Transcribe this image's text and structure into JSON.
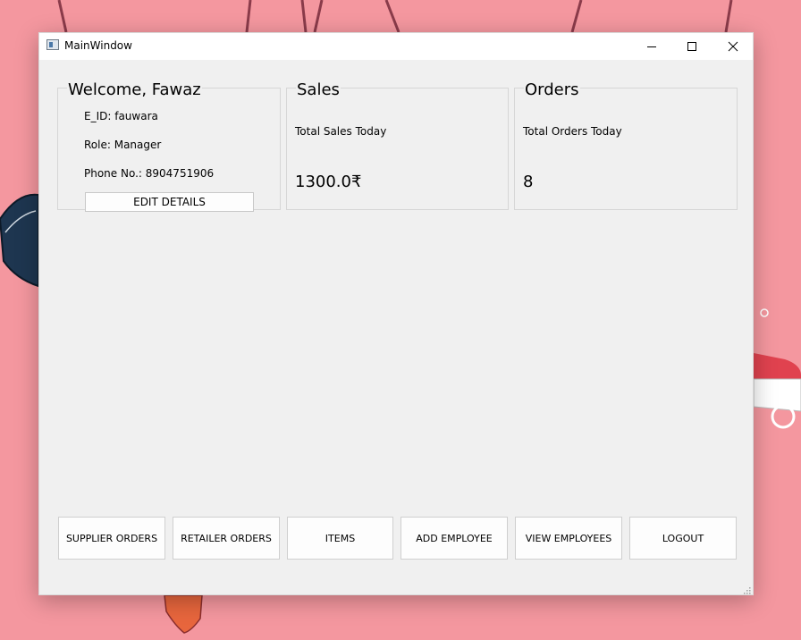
{
  "window": {
    "title": "MainWindow"
  },
  "welcome": {
    "title": "Welcome, Fawaz",
    "eid": "E_ID: fauwara",
    "role": "Role: Manager",
    "phone": "Phone No.: 8904751906",
    "edit_label": "EDIT DETAILS"
  },
  "sales": {
    "title": "Sales",
    "label": "Total Sales Today",
    "value": "1300.0₹"
  },
  "orders": {
    "title": "Orders",
    "label": "Total Orders Today",
    "value": "8"
  },
  "actions": {
    "supplier_orders": "SUPPLIER ORDERS",
    "retailer_orders": "RETAILER ORDERS",
    "items": "ITEMS",
    "add_employee": "ADD EMPLOYEE",
    "view_employees": "VIEW EMPLOYEES",
    "logout": "LOGOUT"
  },
  "colors": {
    "wallpaper": "#f4979f",
    "window_bg": "#f0f0f0",
    "titlebar_bg": "#ffffff"
  }
}
